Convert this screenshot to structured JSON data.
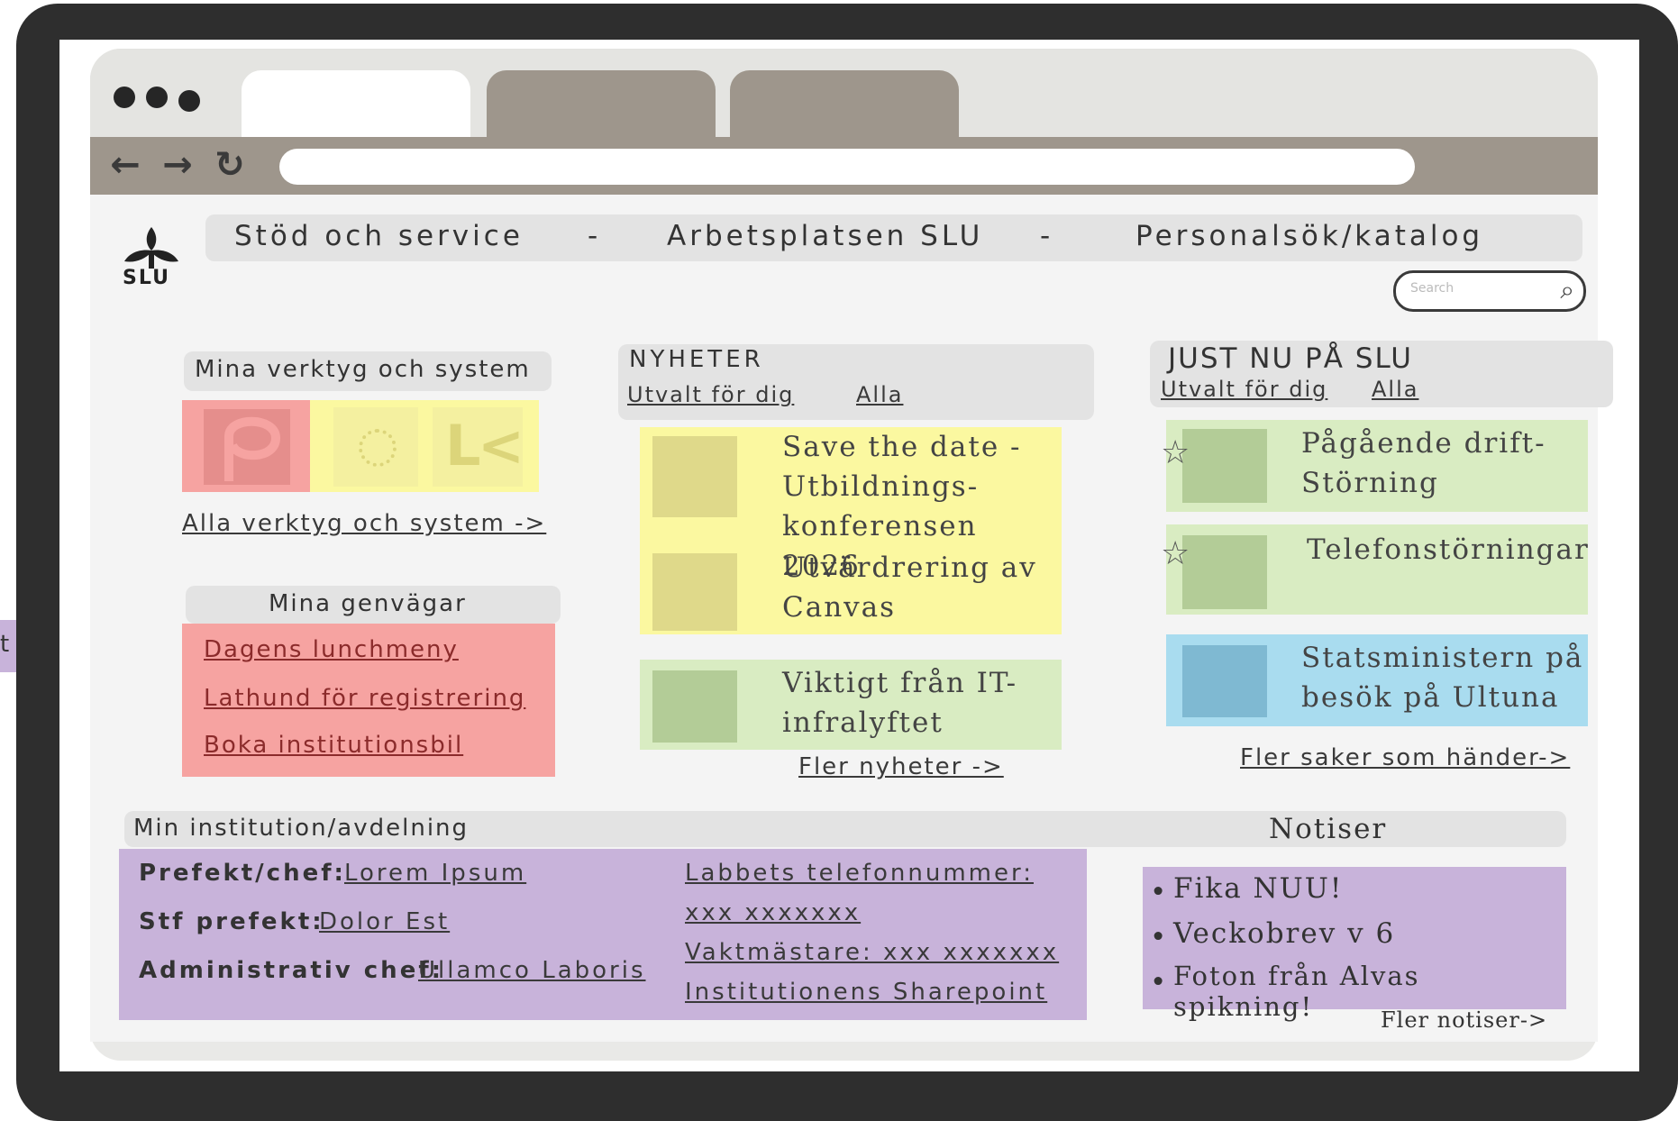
{
  "topnav": {
    "item1": "Stöd och service",
    "sep": "-",
    "item2": "Arbetsplatsen SLU",
    "item3": "Personalsök/katalog"
  },
  "logo": {
    "text": "SLU"
  },
  "search": {
    "placeholder": "Search"
  },
  "tools": {
    "heading": "Mina verktyg och system",
    "all_link": "Alla verktyg och system ->"
  },
  "shortcuts": {
    "heading": "Mina genvägar",
    "items": [
      "Dagens lunchmeny",
      "Lathund för registrering",
      "Boka institutionsbil"
    ]
  },
  "news": {
    "heading": "NYHETER",
    "filter_for_you": "Utvalt för dig",
    "filter_all": "Alla",
    "items": [
      "Save the date -Utbildnings-konferensen 2026",
      "Utvärdrering av Canvas",
      "Viktigt från IT-infralyftet"
    ],
    "more_link": "Fler nyheter ->"
  },
  "now": {
    "heading": "JUST NU PÅ SLU",
    "filter_for_you": "Utvalt för dig",
    "filter_all": "Alla",
    "items": [
      "Pågående drift-Störning",
      "Telefonstörningar",
      "Statsministern på besök på Ultuna"
    ],
    "more_link": "Fler saker som händer->"
  },
  "institution": {
    "heading": "Min institution/avdelning",
    "rows": [
      {
        "label": "Prefekt/chef:",
        "value": "Lorem Ipsum"
      },
      {
        "label": "Stf prefekt:",
        "value": "Dolor Est"
      },
      {
        "label": "Administrativ chef:",
        "value": "Ullamco Laboris"
      }
    ],
    "links": [
      "Labbets telefonnummer:",
      "xxx xxxxxxx",
      "Vaktmästare: xxx xxxxxxx",
      "Institutionens Sharepoint"
    ]
  },
  "notices": {
    "heading": "Notiser",
    "items": [
      "Fika NUU!",
      "Veckobrev v 6",
      "Foton från Alvas spikning!"
    ],
    "more_link": "Fler notiser->"
  },
  "side_tag": {
    "text": "t"
  },
  "colors": {
    "red": "#f6a3a1",
    "yellow": "#fbf8a0",
    "green": "#d9ecc2",
    "blue": "#a9dcef",
    "purple": "#c8b3da",
    "frame": "#2e2e2e",
    "chrome": "#9e968c"
  },
  "icons": [
    "back-arrow-icon",
    "forward-arrow-icon",
    "reload-icon",
    "search-icon",
    "slu-logo-icon",
    "pin-icon"
  ]
}
